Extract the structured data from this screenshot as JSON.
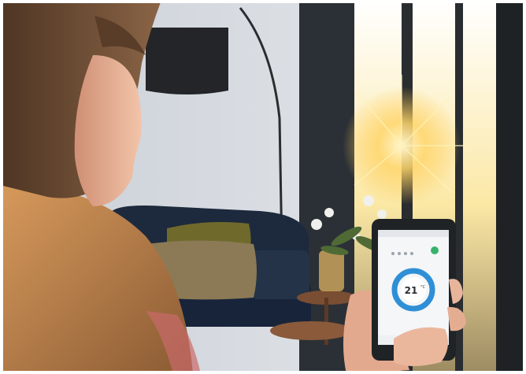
{
  "scene": {
    "description_colors": {
      "wall": "#d9dde2",
      "window_light": "#f7e7b0",
      "sofa": "#1d2a3d",
      "cushion_tan": "#8b7a55",
      "cushion_olive": "#6f6a2c",
      "chair": "#c9864c",
      "hair": "#6b4a33",
      "skin": "#e9b59a",
      "phone_body": "#1f2326",
      "screen_bg": "#f4f6f8",
      "accent_blue": "#2f8fd6",
      "accent_green": "#36b36b"
    }
  },
  "thermostat_app": {
    "temperature": "21",
    "unit": "°C"
  }
}
